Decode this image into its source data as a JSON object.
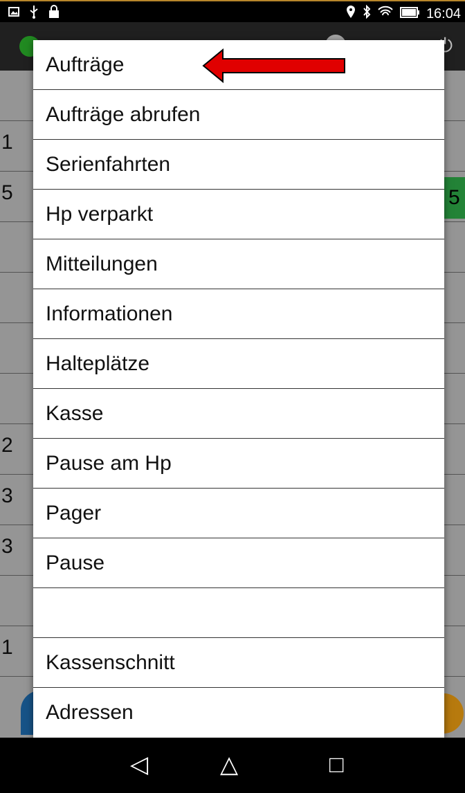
{
  "status_bar": {
    "left_icons": [
      "image-icon",
      "usb-icon",
      "lock-icon"
    ],
    "right_icons": [
      "location-icon",
      "bluetooth-icon",
      "wifi-icon",
      "battery-icon"
    ],
    "time": "16:04"
  },
  "background": {
    "row_numbers": [
      "",
      "1",
      "5",
      "",
      "",
      "",
      "",
      "2",
      "3",
      "3",
      "",
      "1"
    ],
    "right_badge": "5"
  },
  "menu": {
    "items": [
      {
        "label": "Aufträge"
      },
      {
        "label": "Aufträge abrufen"
      },
      {
        "label": "Serienfahrten"
      },
      {
        "label": "Hp verparkt"
      },
      {
        "label": "Mitteilungen"
      },
      {
        "label": "Informationen"
      },
      {
        "label": "Halteplätze"
      },
      {
        "label": "Kasse"
      },
      {
        "label": "Pause am Hp"
      },
      {
        "label": "Pager"
      },
      {
        "label": "Pause"
      },
      {
        "label": ""
      },
      {
        "label": "Kassenschnitt"
      },
      {
        "label": "Adressen"
      }
    ]
  },
  "annotation": {
    "arrow_color": "#e00000"
  },
  "nav_bar": {
    "back": "◁",
    "home": "△",
    "recents": "□"
  }
}
